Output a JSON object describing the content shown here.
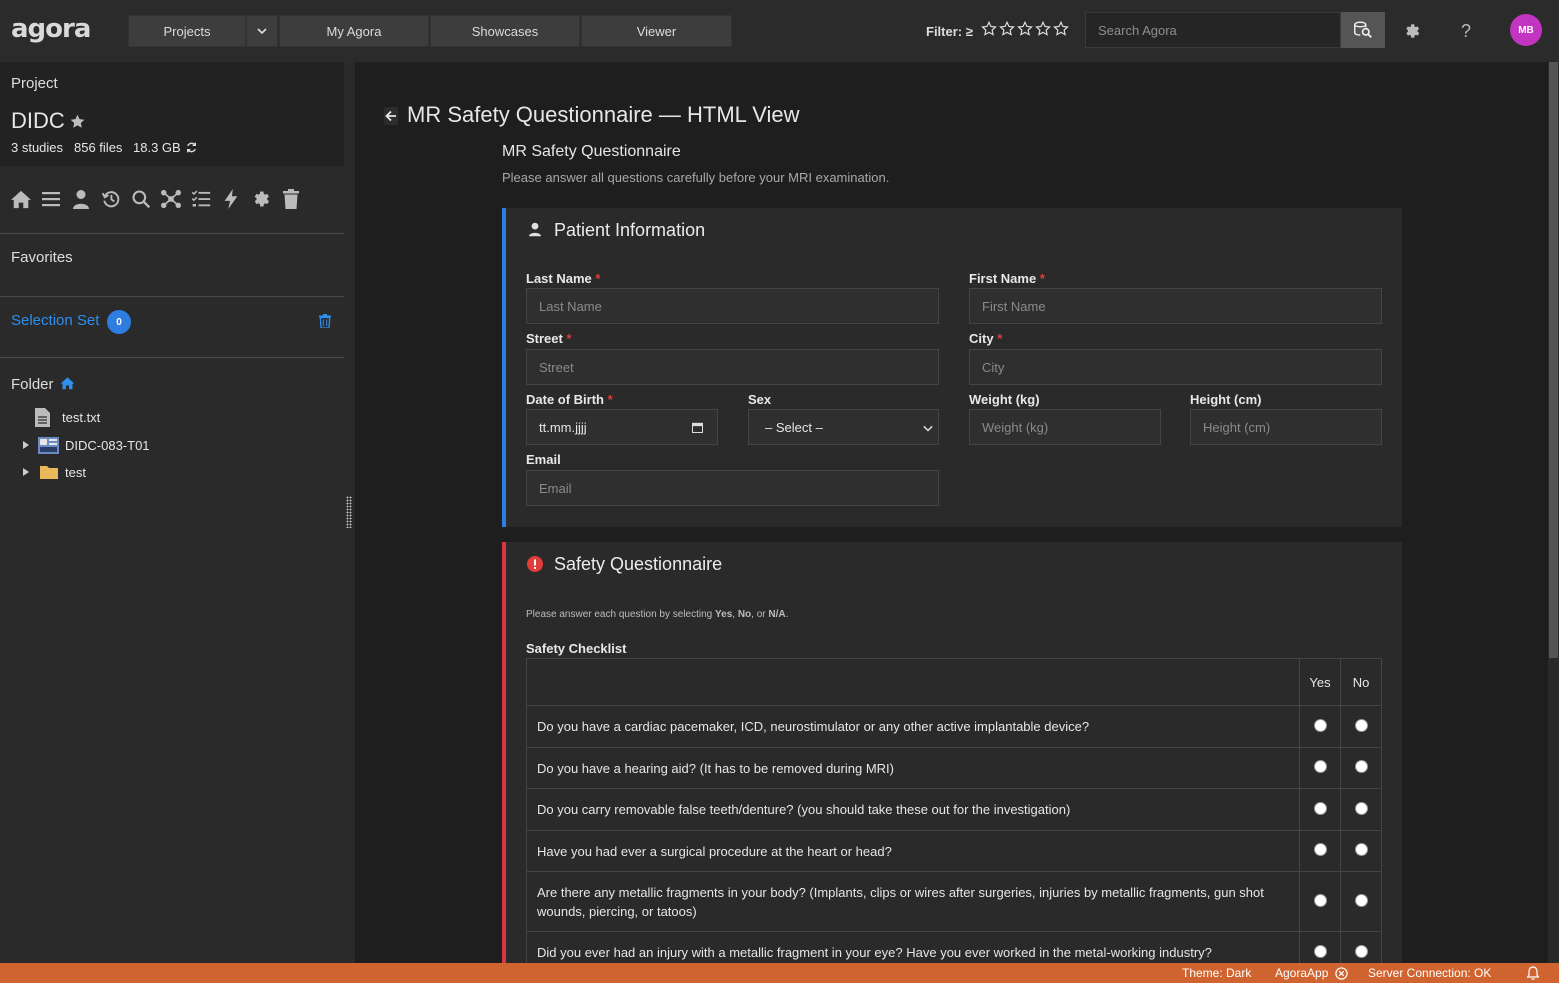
{
  "topbar": {
    "logo": "agora",
    "nav": {
      "projects": "Projects",
      "my_agora": "My Agora",
      "showcases": "Showcases",
      "viewer": "Viewer"
    },
    "filter_label": "Filter: ≥",
    "search_placeholder": "Search Agora",
    "help": "?",
    "avatar": "MB"
  },
  "sidebar": {
    "project_label": "Project",
    "project_name": "DIDC",
    "studies": "3 studies",
    "files": "856 files",
    "size": "18.3 GB",
    "favorites": "Favorites",
    "selection_set": "Selection Set",
    "selection_count": "0",
    "folder": "Folder",
    "tree": [
      {
        "label": "test.txt"
      },
      {
        "label": "DIDC-083-T01"
      },
      {
        "label": "test"
      }
    ]
  },
  "main": {
    "title": "MR Safety Questionnaire — HTML View",
    "form_title": "MR Safety Questionnaire",
    "form_subtitle": "Please answer all questions carefully before your MRI examination.",
    "patient": {
      "heading": "Patient Information",
      "last_name_label": "Last Name",
      "last_name_placeholder": "Last Name",
      "first_name_label": "First Name",
      "first_name_placeholder": "First Name",
      "street_label": "Street",
      "street_placeholder": "Street",
      "city_label": "City",
      "city_placeholder": "City",
      "dob_label": "Date of Birth",
      "dob_value": "tt.mm.jjjj",
      "sex_label": "Sex",
      "sex_value": "– Select –",
      "weight_label": "Weight (kg)",
      "weight_placeholder": "Weight (kg)",
      "height_label": "Height (cm)",
      "height_placeholder": "Height (cm)",
      "email_label": "Email",
      "email_placeholder": "Email"
    },
    "safety": {
      "heading": "Safety Questionnaire",
      "instruction_pre": "Please answer each question by selecting ",
      "instruction_yes": "Yes",
      "instruction_sep": ", ",
      "instruction_no": "No",
      "instruction_or": ", or ",
      "instruction_na": "N/A",
      "instruction_end": ".",
      "checklist_label": "Safety Checklist",
      "col_yes": "Yes",
      "col_no": "No",
      "questions": [
        "Do you have a cardiac pacemaker, ICD, neurostimulator or any other active implantable device?",
        "Do you have a hearing aid? (It has to be removed during MRI)",
        "Do you carry removable false teeth/denture? (you should take these out for the investigation)",
        "Have you had ever a surgical procedure at the heart or head?",
        "Are there any metallic fragments in your body? (Implants, clips or wires after surgeries, injuries by metallic fragments, gun shot wounds, piercing, or tatoos)",
        "Did you ever had an injury with a metallic fragment in your eye? Have you ever worked in the metal-working industry?"
      ]
    }
  },
  "status": {
    "theme": "Theme: Dark",
    "app": "AgoraApp",
    "connection": "Server Connection: OK"
  }
}
